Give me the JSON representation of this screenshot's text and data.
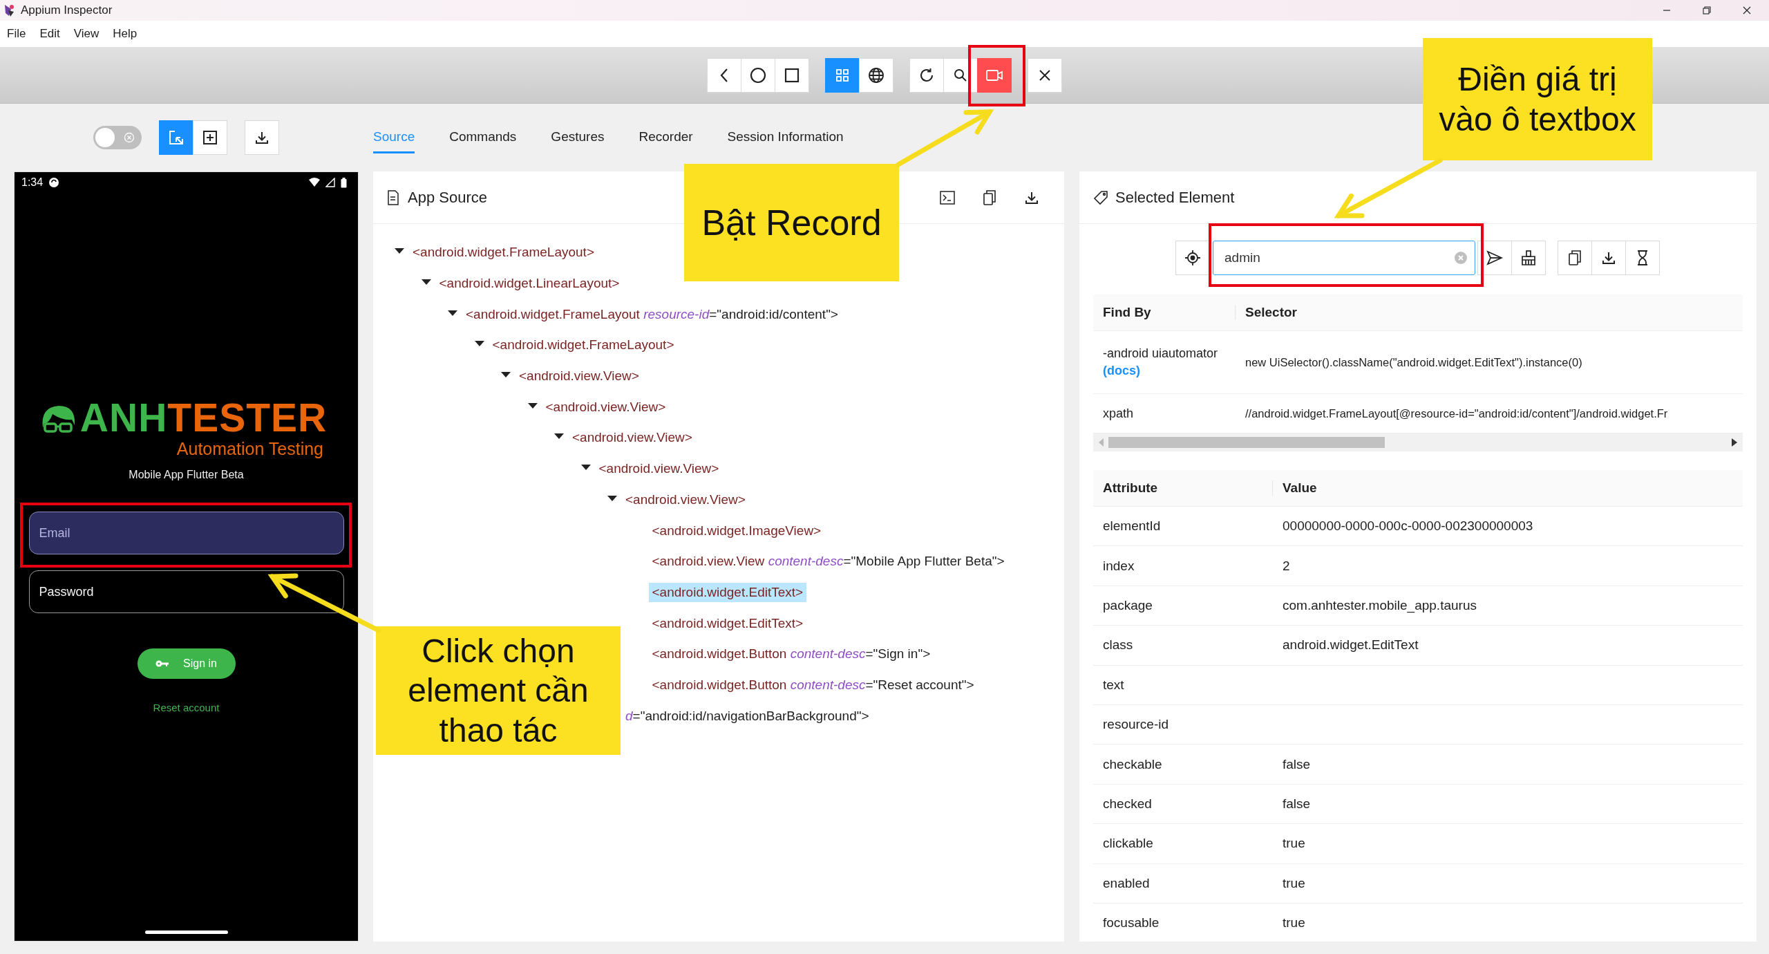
{
  "window": {
    "title": "Appium Inspector"
  },
  "menu": [
    "File",
    "Edit",
    "View",
    "Help"
  ],
  "device_toolbar": [
    {
      "buttons": [
        {
          "kind": "back",
          "selected": false
        },
        {
          "kind": "home",
          "selected": false
        },
        {
          "kind": "recents",
          "selected": false
        }
      ]
    },
    {
      "buttons": [
        {
          "kind": "native",
          "selected": true
        },
        {
          "kind": "web",
          "selected": false
        }
      ]
    },
    {
      "buttons": [
        {
          "kind": "refresh",
          "selected": false
        },
        {
          "kind": "search",
          "selected": false
        },
        {
          "kind": "record",
          "selected": true
        }
      ]
    },
    {
      "buttons": [
        {
          "kind": "quit",
          "selected": false
        }
      ]
    }
  ],
  "inspector_toolbar": {
    "toggle": {
      "on": false
    },
    "modes": [
      {
        "kind": "select",
        "selected": true
      },
      {
        "kind": "tap",
        "selected": false
      }
    ]
  },
  "tabs": [
    {
      "label": "Source",
      "selected": true
    },
    {
      "label": "Commands",
      "selected": false
    },
    {
      "label": "Gestures",
      "selected": false
    },
    {
      "label": "Recorder",
      "selected": false
    },
    {
      "label": "Session Information",
      "selected": false
    }
  ],
  "phone": {
    "time": "1:34",
    "brand_first": "ANH",
    "brand_second": "TESTER",
    "tagline": "Automation Testing",
    "subtitle": "Mobile App Flutter Beta",
    "fields": [
      {
        "placeholder": "Email",
        "highlighted": true
      },
      {
        "placeholder": "Password",
        "highlighted": false
      }
    ],
    "sign_in": "Sign in",
    "reset_link": "Reset account"
  },
  "source_panel": {
    "title": "App Source",
    "tree": [
      {
        "parts": [
          {
            "kind": "tag",
            "text": "<android.widget.FrameLayout>"
          }
        ],
        "expanded": true,
        "selected": false,
        "children": [
          {
            "parts": [
              {
                "kind": "tag",
                "text": "<android.widget.LinearLayout>"
              }
            ],
            "expanded": true,
            "selected": false,
            "children": [
              {
                "parts": [
                  {
                    "kind": "tag",
                    "text": "<android.widget.FrameLayout "
                  },
                  {
                    "kind": "attr",
                    "text": "resource-id"
                  },
                  {
                    "kind": "value",
                    "text": "=\"android:id/content\">"
                  }
                ],
                "expanded": true,
                "selected": false,
                "children": [
                  {
                    "parts": [
                      {
                        "kind": "tag",
                        "text": "<android.widget.FrameLayout>"
                      }
                    ],
                    "expanded": true,
                    "selected": false,
                    "children": [
                      {
                        "parts": [
                          {
                            "kind": "tag",
                            "text": "<android.view.View>"
                          }
                        ],
                        "expanded": true,
                        "selected": false,
                        "children": [
                          {
                            "parts": [
                              {
                                "kind": "tag",
                                "text": "<android.view.View>"
                              }
                            ],
                            "expanded": true,
                            "selected": false,
                            "children": [
                              {
                                "parts": [
                                  {
                                    "kind": "tag",
                                    "text": "<android.view.View>"
                                  }
                                ],
                                "expanded": true,
                                "selected": false,
                                "children": [
                                  {
                                    "parts": [
                                      {
                                        "kind": "tag",
                                        "text": "<android.view.View>"
                                      }
                                    ],
                                    "expanded": true,
                                    "selected": false,
                                    "children": [
                                      {
                                        "parts": [
                                          {
                                            "kind": "tag",
                                            "text": "<android.view.View>"
                                          }
                                        ],
                                        "expanded": true,
                                        "selected": false,
                                        "children": [
                                          {
                                            "parts": [
                                              {
                                                "kind": "tag",
                                                "text": "<android.widget.ImageView>"
                                              }
                                            ],
                                            "selected": false
                                          },
                                          {
                                            "parts": [
                                              {
                                                "kind": "tag",
                                                "text": "<android.view.View "
                                              },
                                              {
                                                "kind": "attr",
                                                "text": "content-desc"
                                              },
                                              {
                                                "kind": "value",
                                                "text": "=\"Mobile App Flutter Beta\">"
                                              }
                                            ],
                                            "selected": false
                                          },
                                          {
                                            "parts": [
                                              {
                                                "kind": "tag",
                                                "text": "<android.widget.EditText>"
                                              }
                                            ],
                                            "selected": true
                                          },
                                          {
                                            "parts": [
                                              {
                                                "kind": "tag",
                                                "text": "<android.widget.EditText>"
                                              }
                                            ],
                                            "selected": false
                                          },
                                          {
                                            "parts": [
                                              {
                                                "kind": "tag",
                                                "text": "<android.widget.Button "
                                              },
                                              {
                                                "kind": "attr",
                                                "text": "content-desc"
                                              },
                                              {
                                                "kind": "value",
                                                "text": "=\"Sign in\">"
                                              }
                                            ],
                                            "selected": false
                                          },
                                          {
                                            "parts": [
                                              {
                                                "kind": "tag",
                                                "text": "<android.widget.Button "
                                              },
                                              {
                                                "kind": "attr",
                                                "text": "content-desc"
                                              },
                                              {
                                                "kind": "value",
                                                "text": "=\"Reset account\">"
                                              }
                                            ],
                                            "selected": false
                                          }
                                        ]
                                      },
                                      {
                                        "parts": [
                                          {
                                            "kind": "attr",
                                            "text": "d"
                                          },
                                          {
                                            "kind": "value",
                                            "text": "=\"android:id/navigationBarBackground\">"
                                          }
                                        ],
                                        "selected": false
                                      }
                                    ]
                                  }
                                ]
                              }
                            ]
                          }
                        ]
                      }
                    ]
                  }
                ]
              }
            ]
          }
        ]
      }
    ]
  },
  "selected_panel": {
    "title": "Selected Element",
    "locator_input": {
      "value": "admin"
    },
    "selectors": {
      "columns": [
        "Find By",
        "Selector"
      ],
      "rows": [
        {
          "find_by": "-android uiautomator",
          "docs_link": "(docs)",
          "selector": "new UiSelector().className(\"android.widget.EditText\").instance(0)"
        },
        {
          "find_by": "xpath",
          "selector": "//android.widget.FrameLayout[@resource-id=\"android:id/content\"]/android.widget.Fr"
        }
      ]
    },
    "attributes": {
      "columns": [
        "Attribute",
        "Value"
      ],
      "rows": [
        {
          "name": "elementId",
          "value": "00000000-0000-000c-0000-002300000003"
        },
        {
          "name": "index",
          "value": "2"
        },
        {
          "name": "package",
          "value": "com.anhtester.mobile_app.taurus"
        },
        {
          "name": "class",
          "value": "android.widget.EditText"
        },
        {
          "name": "text"
        },
        {
          "name": "resource-id"
        },
        {
          "name": "checkable",
          "value": "false"
        },
        {
          "name": "checked",
          "value": "false"
        },
        {
          "name": "clickable",
          "value": "true"
        },
        {
          "name": "enabled",
          "value": "true"
        },
        {
          "name": "focusable",
          "value": "true"
        }
      ]
    }
  },
  "callouts": [
    {
      "text": "Bật Record"
    },
    {
      "text": "Điền giá trị vào ô textbox"
    },
    {
      "text": "Click chọn element cần thao tác"
    }
  ]
}
